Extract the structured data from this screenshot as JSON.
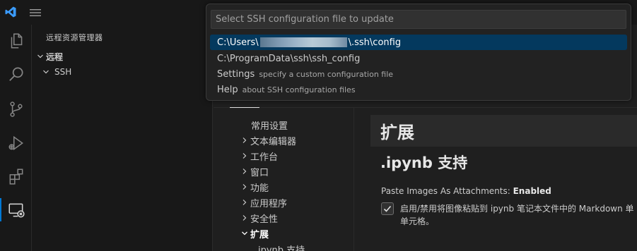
{
  "topbar": {
    "logo_icon": "vscode-logo-icon",
    "menu_icon": "hamburger-menu-icon"
  },
  "activity_bar": {
    "items": [
      {
        "icon": "explorer-icon"
      },
      {
        "icon": "search-icon"
      },
      {
        "icon": "source-control-icon"
      },
      {
        "icon": "run-debug-icon"
      },
      {
        "icon": "extensions-icon"
      },
      {
        "icon": "remote-explorer-icon"
      }
    ],
    "active_color": "#0078d4"
  },
  "sidebar": {
    "title": "远程资源管理器",
    "tree": [
      {
        "label": "远程",
        "expanded": true
      },
      {
        "label": "SSH",
        "expanded": true
      }
    ]
  },
  "quick_pick": {
    "placeholder": "Select SSH configuration file to update",
    "items": [
      {
        "prefix": "C:\\Users\\",
        "suffix": "\\.ssh\\config",
        "focused": true
      },
      {
        "label": "C:\\ProgramData\\ssh\\ssh_config"
      },
      {
        "label": "Settings",
        "description": "specify a custom configuration file"
      },
      {
        "label": "Help",
        "description": "about SSH configuration files"
      }
    ],
    "focus_color": "#04395e"
  },
  "settings_toc": {
    "items": [
      {
        "label": "常用设置"
      },
      {
        "label": "文本编辑器"
      },
      {
        "label": "工作台"
      },
      {
        "label": "窗口"
      },
      {
        "label": "功能"
      },
      {
        "label": "应用程序"
      },
      {
        "label": "安全性"
      },
      {
        "label": "扩展"
      },
      {
        "label": "ipynb 支持"
      }
    ]
  },
  "settings_content": {
    "section_title": "扩展",
    "subsection_title": ".ipynb 支持",
    "setting": {
      "name": "Paste Images As Attachments:",
      "key_part": "Enabled",
      "checked": true,
      "description_line1": "启用/禁用将图像粘贴到 ipynb 笔记本文件中的 Markdown 单",
      "description_line2": "单元格。"
    }
  }
}
